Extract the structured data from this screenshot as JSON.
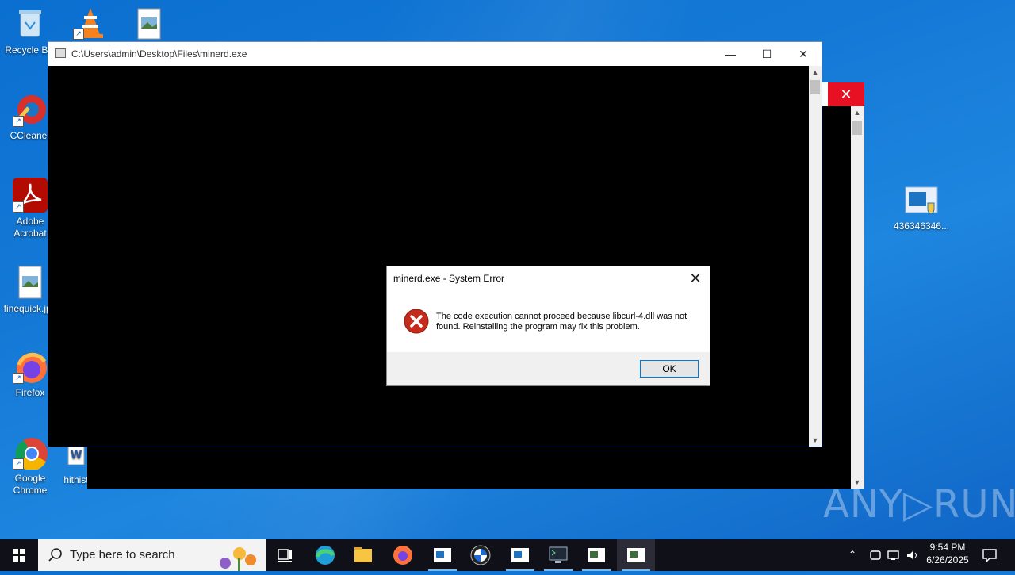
{
  "desktop": {
    "icons": [
      {
        "label": "Recycle Bin"
      },
      {
        "label": "CCleaner"
      },
      {
        "label": "Adobe Acrobat"
      },
      {
        "label": "finequick.jpg"
      },
      {
        "label": "Firefox"
      },
      {
        "label": "Google Chrome"
      },
      {
        "label": "hithist"
      },
      {
        "label": "436346346..."
      }
    ]
  },
  "console": {
    "title": "C:\\Users\\admin\\Desktop\\Files\\minerd.exe",
    "minimize": "—",
    "maximize": "☐",
    "close": "✕"
  },
  "back_window": {
    "close": "✕"
  },
  "dialog": {
    "title": "minerd.exe - System Error",
    "close": "✕",
    "message": "The code execution cannot proceed because libcurl-4.dll was not found. Reinstalling the program may fix this problem.",
    "ok_label": "OK"
  },
  "taskbar": {
    "search_placeholder": "Type here to search",
    "time": "9:54 PM",
    "date": "6/26/2025"
  },
  "watermark": "ANY▷RUN",
  "colors": {
    "desktop": "#1479d6",
    "close_red": "#e81123",
    "taskbar": "#101018"
  }
}
